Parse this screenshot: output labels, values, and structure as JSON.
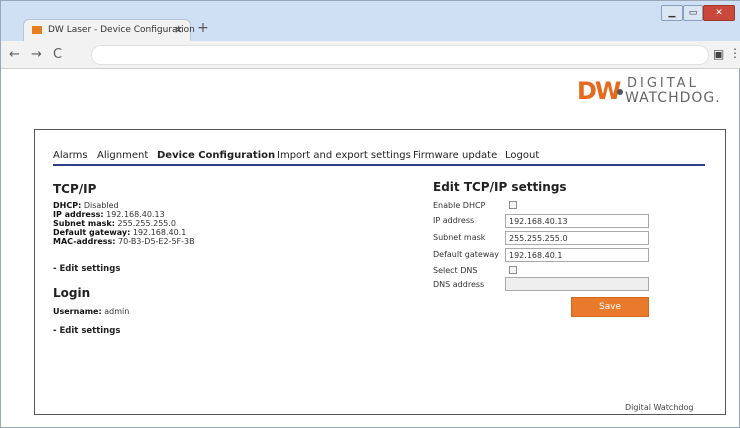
{
  "browser": {
    "tab_title": "DW Laser - Device Configuration",
    "tab_close": "×",
    "new_tab": "+",
    "window_min": "▁",
    "window_max": "▭",
    "window_close": "✕",
    "back": "←",
    "forward": "→",
    "reload": "C",
    "ext_icon": "▣",
    "menu_icon": "⋮"
  },
  "logo": {
    "mark": "DW",
    "line1": "DIGITAL",
    "line2": "WATCHDOG."
  },
  "nav": {
    "items": [
      {
        "label": "Alarms",
        "active": false
      },
      {
        "label": "Alignment",
        "active": false
      },
      {
        "label": "Device Configuration",
        "active": true
      },
      {
        "label": "Import and export settings",
        "active": false
      },
      {
        "label": "Firmware update",
        "active": false
      },
      {
        "label": "Logout",
        "active": false
      }
    ]
  },
  "tcpip": {
    "heading": "TCP/IP",
    "dhcp_key": "DHCP:",
    "dhcp_val": "Disabled",
    "ip_key": "IP address:",
    "ip_val": "192.168.40.13",
    "mask_key": "Subnet mask:",
    "mask_val": "255.255.255.0",
    "gw_key": "Default gateway:",
    "gw_val": "192.168.40.1",
    "mac_key": "MAC-address:",
    "mac_val": "70-B3-D5-E2-5F-3B",
    "edit_link": "- Edit settings"
  },
  "login": {
    "heading": "Login",
    "user_key": "Username:",
    "user_val": "admin",
    "edit_link": "- Edit settings"
  },
  "edit_form": {
    "heading": "Edit TCP/IP settings",
    "enable_dhcp_label": "Enable DHCP",
    "ip_label": "IP address",
    "ip_value": "192.168.40.13",
    "mask_label": "Subnet mask",
    "mask_value": "255.255.255.0",
    "gw_label": "Default gateway",
    "gw_value": "192.168.40.1",
    "select_dns_label": "Select DNS",
    "dns_label": "DNS address",
    "dns_value": "",
    "save_label": "Save"
  },
  "footer": {
    "text": "Digital Watchdog"
  },
  "colors": {
    "accent": "#e97a2b",
    "nav_underline": "#2d3f8a"
  }
}
